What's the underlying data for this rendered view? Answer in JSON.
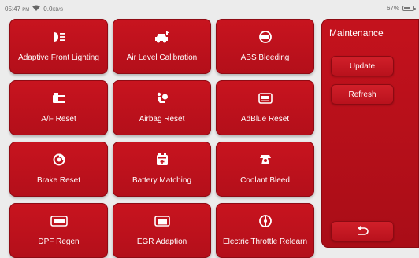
{
  "status_bar": {
    "time": "05:47",
    "ampm": "PM",
    "net_speed": "0.0",
    "net_unit": "KB/S",
    "battery_percent": "67%",
    "battery_level": 0.67,
    "icons": [
      "wifi-icon",
      "battery-icon"
    ]
  },
  "functions": [
    {
      "label": "Adaptive Front Lighting",
      "icon": "headlight-icon"
    },
    {
      "label": "Air Level Calibration",
      "icon": "car-suspension-icon"
    },
    {
      "label": "ABS Bleeding",
      "icon": "abs-icon"
    },
    {
      "label": "A/F Reset",
      "icon": "af-sensor-icon"
    },
    {
      "label": "Airbag Reset",
      "icon": "airbag-icon"
    },
    {
      "label": "AdBlue Reset",
      "icon": "adblue-icon"
    },
    {
      "label": "Brake Reset",
      "icon": "brake-disc-icon"
    },
    {
      "label": "Battery Matching",
      "icon": "battery-matching-icon"
    },
    {
      "label": "Coolant Bleed",
      "icon": "coolant-icon"
    },
    {
      "label": "DPF Regen",
      "icon": "dpf-icon"
    },
    {
      "label": "EGR Adaption",
      "icon": "egr-icon"
    },
    {
      "label": "Electric Throttle Relearn",
      "icon": "throttle-icon"
    }
  ],
  "panel": {
    "title": "Maintenance",
    "update_label": "Update",
    "refresh_label": "Refresh",
    "back_icon": "back-arrow-icon"
  },
  "colors": {
    "accent": "#c8141f",
    "panel": "#b30f1a",
    "background": "#ececec"
  }
}
